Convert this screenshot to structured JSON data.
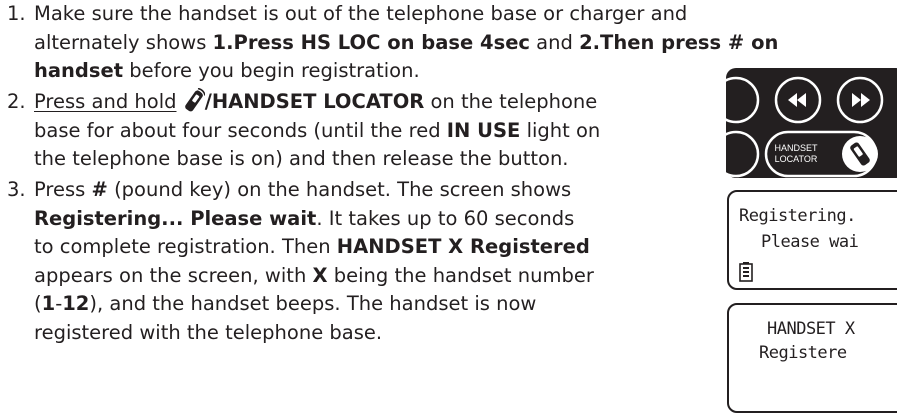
{
  "steps": [
    {
      "number": "1.",
      "lines": [
        [
          "Make sure the handset is out of the telephone base or charger and"
        ],
        [
          "alternately shows ",
          {
            "b": "1.Press HS LOC on base 4sec"
          },
          " and ",
          {
            "b": "2.Then press # on"
          }
        ],
        [
          {
            "b": "handset"
          },
          " before you begin registration."
        ]
      ]
    },
    {
      "number": "2.",
      "lines": [
        [
          {
            "u": "Press and hold"
          },
          " ",
          {
            "icon": "handset-locator-icon"
          },
          {
            "b": "/HANDSET LOCATOR"
          },
          " on the telephone"
        ],
        [
          "base for about four seconds (until the red ",
          {
            "b": "IN USE"
          },
          " light on"
        ],
        [
          "the telephone base is on) and then release the button."
        ]
      ]
    },
    {
      "number": "3.",
      "lines": [
        [
          "Press ",
          {
            "b": "#"
          },
          " (pound key) on the handset. The screen shows"
        ],
        [
          {
            "b": "Registering... Please wait"
          },
          ". It takes up to 60 seconds"
        ],
        [
          "to complete registration. Then ",
          {
            "b": "HANDSET X Registered"
          }
        ],
        [
          "appears on the screen, with ",
          {
            "b": "X"
          },
          " being the handset number"
        ],
        [
          "(",
          {
            "b": "1"
          },
          "-",
          {
            "b": "12"
          },
          "), and the handset beeps. The handset is now"
        ],
        [
          "registered with the telephone base."
        ]
      ]
    }
  ],
  "base_panel": {
    "locator_button_label": [
      "HANDSET",
      "LOCATOR"
    ]
  },
  "screen_registering": {
    "line1": "Registering.",
    "line2": "Please wai"
  },
  "screen_registered": {
    "line1": "HANDSET X",
    "line2": "Registere"
  },
  "colors": {
    "text": "#231f20",
    "button_fill": "#231f20",
    "button_ring": "#ffffff"
  }
}
